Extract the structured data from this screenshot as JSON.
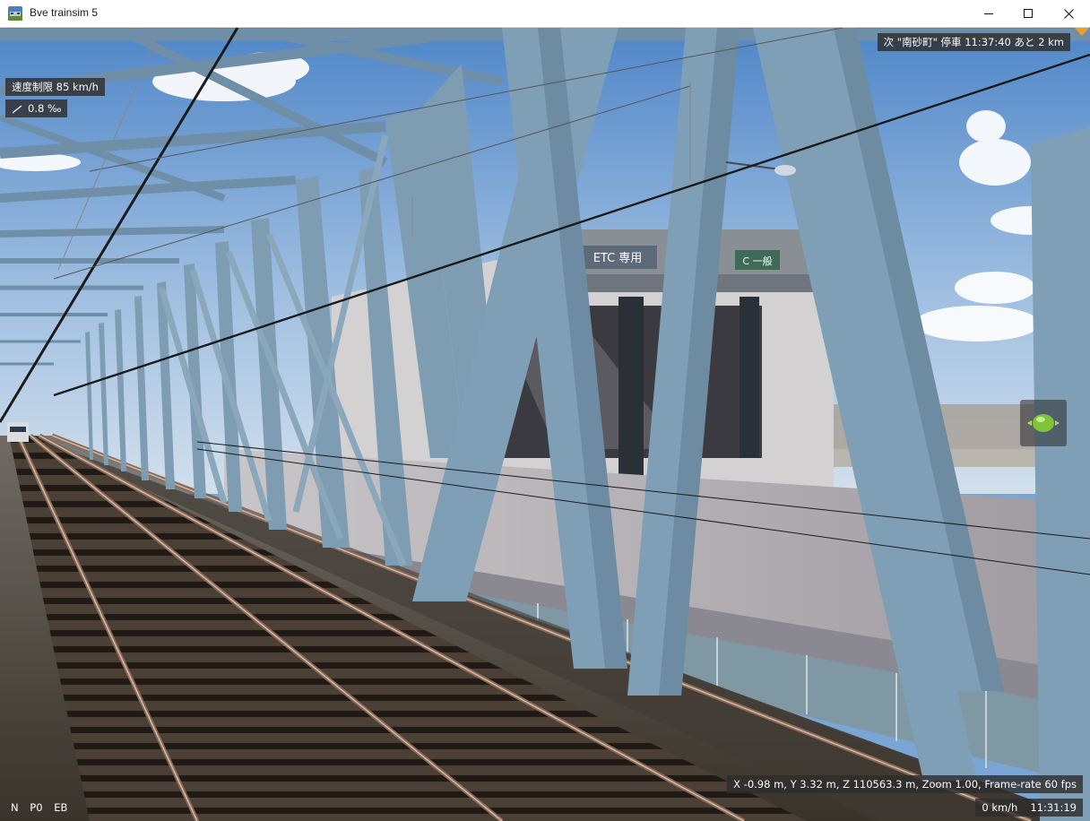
{
  "window": {
    "title": "Bve trainsim 5",
    "controls": {
      "minimize": "minimize-icon",
      "maximize": "maximize-icon",
      "close": "close-icon"
    }
  },
  "hud": {
    "speed_limit": "速度制限 85 km/h",
    "gradient": "0.8 ‰",
    "next_station": "次 \"南砂町\" 停車 11:37:40 あと 2 km",
    "coordinates": "X -0.98 m, Y 3.32 m, Z 110563.3 m, Zoom 1.00, Frame-rate 60 fps",
    "speed": "0 km/h",
    "clock": "11:31:19",
    "notches": [
      "N",
      "P0",
      "EB"
    ]
  },
  "scene": {
    "signboard": "ETC 専用",
    "signboard_partial": "C 一般"
  },
  "colors": {
    "truss": "#7e9db3",
    "sky": "#7aa6d6",
    "accent": "#f0a020"
  }
}
